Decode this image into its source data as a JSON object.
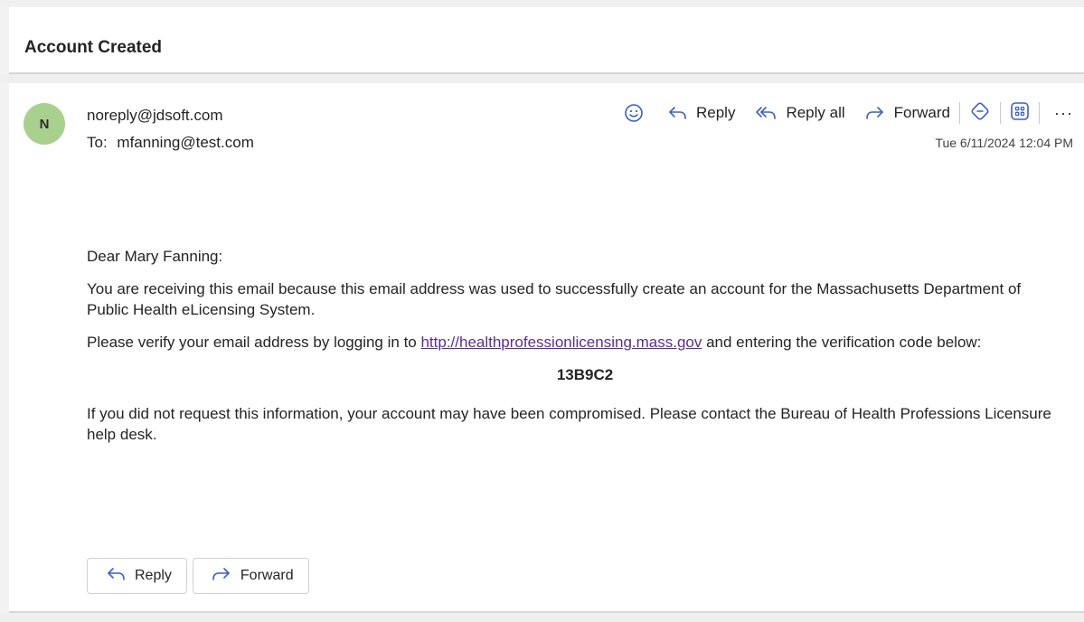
{
  "subject": "Account Created",
  "message": {
    "avatar_initial": "N",
    "sender": "noreply@jdsoft.com",
    "to_label": "To:",
    "to": "mfanning@test.com",
    "date": "Tue 6/11/2024 12:04 PM",
    "toolbar": {
      "reply_label": "Reply",
      "reply_all_label": "Reply all",
      "forward_label": "Forward",
      "more_label": "···"
    },
    "body": {
      "greeting": "Dear Mary Fanning:",
      "para1": "You are receiving this email because this email address was used to successfully create an account for the Massachusetts Department of Public Health eLicensing System.",
      "para2_pre": "Please verify your email address by logging in to ",
      "para2_link": "http://healthprofessionlicensing.mass.gov",
      "para2_post": " and entering the verification code below:",
      "code": "13B9C2",
      "para3": "If you did not request this information, your account may have been compromised. Please contact the Bureau of Health Professions Licensure help desk."
    },
    "actions": {
      "reply_label": "Reply",
      "forward_label": "Forward"
    }
  },
  "colors": {
    "avatar_bg": "#a9d18e",
    "link": "#5b2e91",
    "icon_blue": "#3a5fcd"
  },
  "icons": [
    "emoji-icon",
    "reply-icon",
    "reply-all-icon",
    "forward-icon",
    "loop-icon",
    "apps-icon",
    "more-icon"
  ]
}
